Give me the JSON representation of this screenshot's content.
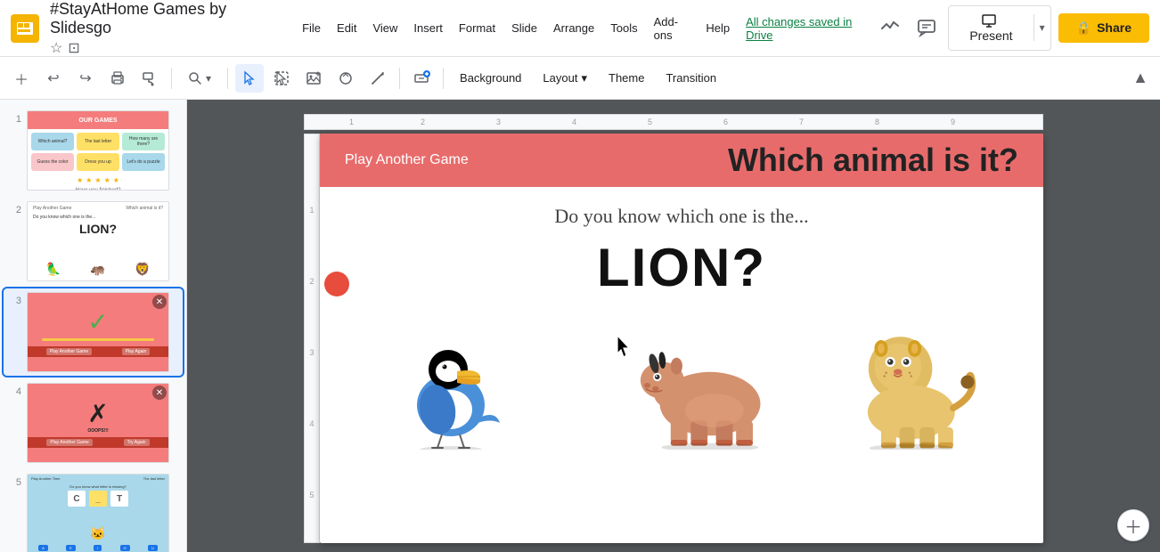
{
  "app": {
    "icon": "📊",
    "title": "#StayAtHome Games by Slidesgo",
    "save_status": "All changes saved in Drive"
  },
  "menu": {
    "items": [
      "File",
      "Edit",
      "View",
      "Insert",
      "Format",
      "Slide",
      "Arrange",
      "Tools",
      "Add-ons",
      "Help"
    ]
  },
  "topbar": {
    "present_label": "Present",
    "share_label": "Share",
    "share_icon": "🔒"
  },
  "toolbar": {
    "background_label": "Background",
    "layout_label": "Layout",
    "theme_label": "Theme",
    "transition_label": "Transition"
  },
  "slides": [
    {
      "num": "1",
      "active": false
    },
    {
      "num": "2",
      "active": false
    },
    {
      "num": "3",
      "active": false
    },
    {
      "num": "4",
      "active": false
    },
    {
      "num": "5",
      "active": true
    }
  ],
  "current_slide": {
    "header_left": "Play Another Game",
    "header_right": "Which animal is it?",
    "subtitle": "Do you know which one is the...",
    "main_text": "LION?"
  }
}
